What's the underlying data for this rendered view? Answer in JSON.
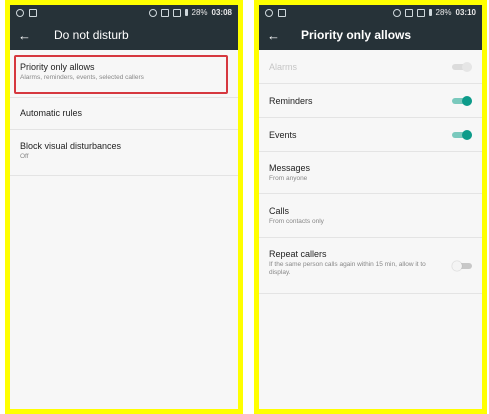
{
  "left_screen": {
    "status": {
      "time": "03:08",
      "battery": "28%"
    },
    "title": "Do not disturb",
    "items": [
      {
        "title": "Priority only allows",
        "subtitle": "Alarms, reminders, events, selected callers"
      },
      {
        "title": "Automatic rules",
        "subtitle": ""
      },
      {
        "title": "Block visual disturbances",
        "subtitle": "Off"
      }
    ]
  },
  "right_screen": {
    "status": {
      "time": "03:10",
      "battery": "28%"
    },
    "title": "Priority only allows",
    "items": [
      {
        "title": "Alarms",
        "toggle": "disabled"
      },
      {
        "title": "Reminders",
        "toggle": "on"
      },
      {
        "title": "Events",
        "toggle": "on"
      },
      {
        "title": "Messages",
        "subtitle": "From anyone"
      },
      {
        "title": "Calls",
        "subtitle": "From contacts only"
      },
      {
        "title": "Repeat callers",
        "subtitle": "If the same person calls again within 15 min, allow it to display.",
        "toggle": "off"
      }
    ]
  },
  "colors": {
    "appbar": "#263238",
    "accent": "#0d9b8a",
    "highlight": "#d6383f",
    "frame": "#ffff00"
  }
}
